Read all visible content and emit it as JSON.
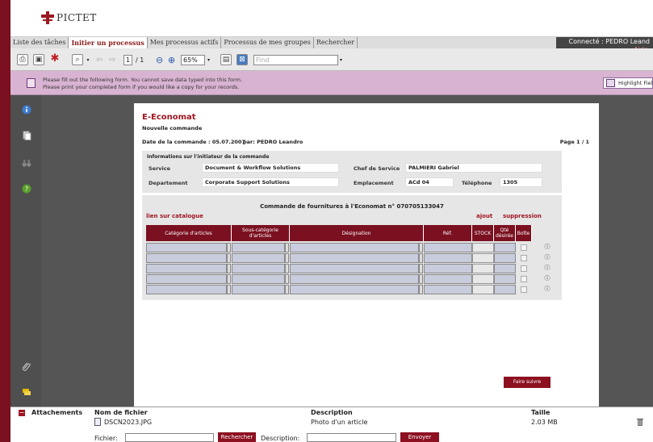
{
  "brand": {
    "name": "PICTET"
  },
  "header": {
    "connected": "Connecté : PEDRO Leand",
    "help": "Aide"
  },
  "tabs": [
    {
      "label": "Liste des tâches"
    },
    {
      "label": "Initier un processus"
    },
    {
      "label": "Mes processus actifs"
    },
    {
      "label": "Processus de mes groupes"
    },
    {
      "label": "Rechercher"
    }
  ],
  "toolbar": {
    "page_current": "1",
    "page_total": "/ 1",
    "zoom": "65%",
    "find_placeholder": "Find"
  },
  "notice": {
    "line1": "Please fill out the following form. You cannot save data typed into this form.",
    "line2": "Please print your completed form if you would like a copy for your records.",
    "highlight_button": "Highlight Fields"
  },
  "sidebar": {
    "icons": [
      "info-icon",
      "pages-icon",
      "binoculars-icon",
      "help-icon",
      "paperclip-icon",
      "comment-icon"
    ]
  },
  "form": {
    "title": "E-Economat",
    "subtitle": "Nouvelle commande",
    "date_label": "Date de la commande : 05.07.2007",
    "par_label": "par:  PEDRO Leandro",
    "page_label": "Page   1 / 1",
    "info": {
      "heading": "Informations sur l'initiateur de la commande",
      "service_label": "Service",
      "service_value": "Document & Workflow Solutions",
      "chef_label": "Chef de Service",
      "chef_value": "PALMIERI Gabriel",
      "dept_label": "Departement",
      "dept_value": "Corporate Support Solutions",
      "empl_label": "Emplacement",
      "empl_value": "ACd 04",
      "tel_label": "Téléphone",
      "tel_value": "1305"
    },
    "order": {
      "title": "Commande de fournitures à l'Economat n° 070705133047",
      "catalogue_link": "lien sur catalogue",
      "add": "ajout",
      "remove": "suppression",
      "columns": [
        "Catégorie d'articles",
        "Sous-catégorie d'articles",
        "Désignation",
        "Réf.",
        "STOCK",
        "Qté désirée",
        "Boîte"
      ],
      "row_count": 5
    },
    "submit": "Faire suivre"
  },
  "attachments": {
    "title": "Attachements",
    "col_file": "Nom de fichier",
    "col_desc": "Description",
    "col_size": "Taille",
    "file_name": "DSCN2023.JPG",
    "file_desc": "Photo d'un article",
    "file_size": "2.03 MB",
    "fichier_label": "Fichier:",
    "browse": "Rechercher",
    "desc_label": "Description:",
    "send": "Envoyer"
  },
  "colors": {
    "brand": "#7a1020",
    "accent": "#a01520",
    "notice": "#d9b3d2",
    "stage": "#555555"
  }
}
